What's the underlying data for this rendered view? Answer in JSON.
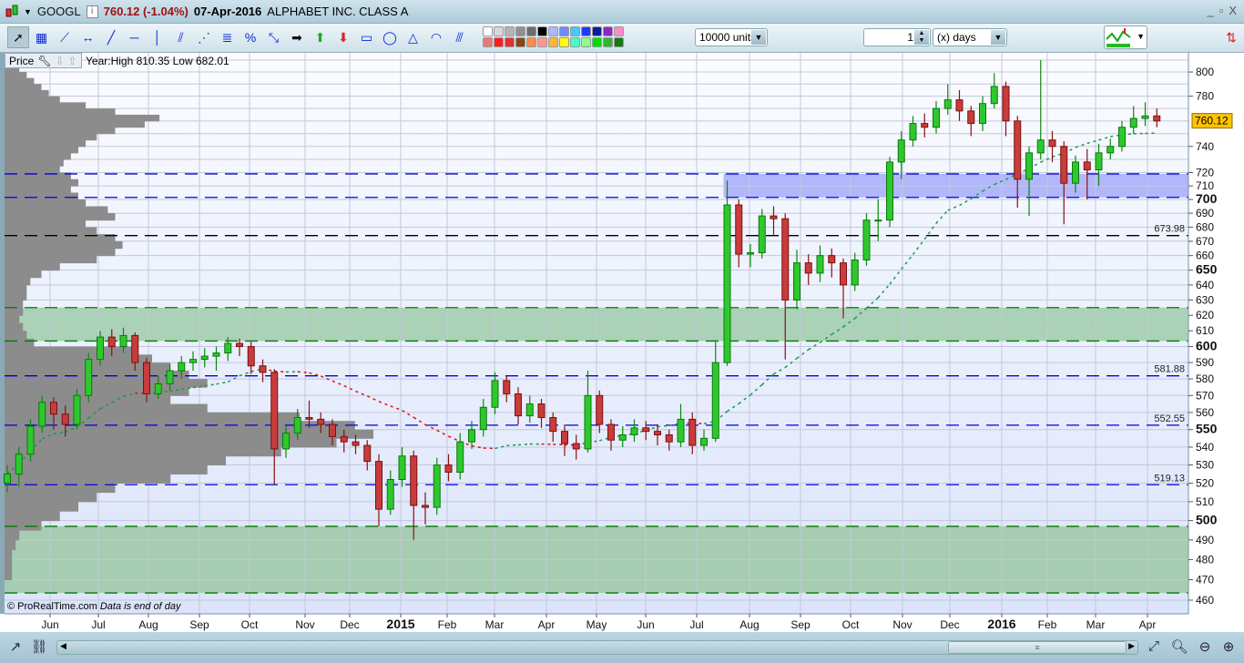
{
  "header": {
    "symbol": "GOOGL",
    "price_change": "760.12 (-1.04%)",
    "date": "07-Apr-2016",
    "name": "ALPHABET INC. CLASS A",
    "info": "i"
  },
  "window_controls": {
    "minimize": "_",
    "restore": "▫",
    "close": "X"
  },
  "toolbar": {
    "tools": [
      "pointer",
      "ruler",
      "line-segment",
      "horizontal-measure",
      "trend-line",
      "horizontal-line",
      "vertical-line",
      "channel",
      "fan-lines",
      "fibonacci-retracement",
      "percent-retracement",
      "point-to-point",
      "arrow-black",
      "arrow-up-green",
      "arrow-down-red",
      "rectangle",
      "ellipse",
      "triangle",
      "fibonacci-arcs",
      "fibonacci-fan"
    ],
    "palette": [
      "#ffffff",
      "#d8d8d8",
      "#b4b4b4",
      "#909090",
      "#6c6c6c",
      "#000000",
      "#aab8ff",
      "#6e8cff",
      "#46c8ff",
      "#1e3cff",
      "#0a1e9a",
      "#8c28c8",
      "#ff8cc8",
      "#e87878",
      "#ff1e1e",
      "#e03030",
      "#8c4614",
      "#ff8c46",
      "#ff9696",
      "#ffb432",
      "#ffff00",
      "#46ffc8",
      "#8cff8c",
      "#00dc00",
      "#32b432",
      "#147814"
    ],
    "units": "10000 units",
    "period_value": "1",
    "period_unit": "(x) days"
  },
  "panel": {
    "label": "Price",
    "year_info": "Year:High 810.35 Low 682.01",
    "copyright": "© ProRealTime.com",
    "data_note": "Data is end of day"
  },
  "chart_data": {
    "type": "candlestick",
    "interval": "weekly",
    "symbol": "GOOGL",
    "scale": "log",
    "ylim": [
      460,
      816
    ],
    "last_price": "760.12",
    "x_ticks": [
      "Jun",
      "Jul",
      "Aug",
      "Sep",
      "Oct",
      "Nov",
      "Dec",
      "2015",
      "Feb",
      "Mar",
      "Apr",
      "May",
      "Jun",
      "Jul",
      "Aug",
      "Sep",
      "Oct",
      "Nov",
      "Dec",
      "2016",
      "Feb",
      "Mar",
      "Apr"
    ],
    "y_ticks": [
      800,
      780,
      740,
      720,
      710,
      700,
      690,
      680,
      670,
      660,
      650,
      640,
      630,
      620,
      610,
      600,
      590,
      580,
      570,
      560,
      550,
      540,
      530,
      520,
      510,
      500,
      490,
      480,
      470,
      460
    ],
    "y_ticks_bold": [
      700,
      650,
      600,
      550,
      500
    ],
    "candles": [
      [
        520,
        530,
        515,
        525
      ],
      [
        525,
        540,
        518,
        536
      ],
      [
        536,
        556,
        532,
        552
      ],
      [
        552,
        570,
        548,
        566
      ],
      [
        566,
        569,
        550,
        559
      ],
      [
        559,
        564,
        546,
        553
      ],
      [
        553,
        574,
        550,
        570
      ],
      [
        570,
        596,
        566,
        592
      ],
      [
        592,
        610,
        588,
        606
      ],
      [
        606,
        611,
        594,
        600
      ],
      [
        600,
        612,
        596,
        607
      ],
      [
        607,
        609,
        585,
        590
      ],
      [
        590,
        593,
        566,
        571
      ],
      [
        571,
        582,
        568,
        577
      ],
      [
        577,
        589,
        573,
        585
      ],
      [
        585,
        594,
        580,
        590
      ],
      [
        590,
        597,
        585,
        592
      ],
      [
        592,
        599,
        587,
        594
      ],
      [
        594,
        600,
        585,
        596
      ],
      [
        596,
        606,
        591,
        602
      ],
      [
        602,
        605,
        594,
        600
      ],
      [
        600,
        603,
        583,
        588
      ],
      [
        588,
        592,
        578,
        584
      ],
      [
        584,
        586,
        519,
        539
      ],
      [
        539,
        552,
        534,
        548
      ],
      [
        548,
        562,
        544,
        557
      ],
      [
        557,
        567,
        551,
        556
      ],
      [
        556,
        560,
        548,
        553
      ],
      [
        553,
        556,
        541,
        546
      ],
      [
        546,
        550,
        537,
        543
      ],
      [
        543,
        547,
        536,
        541
      ],
      [
        541,
        544,
        527,
        532
      ],
      [
        532,
        536,
        497,
        506
      ],
      [
        506,
        527,
        503,
        522
      ],
      [
        522,
        540,
        518,
        535
      ],
      [
        535,
        538,
        490,
        508
      ],
      [
        508,
        515,
        498,
        507
      ],
      [
        507,
        534,
        503,
        530
      ],
      [
        530,
        536,
        521,
        526
      ],
      [
        526,
        548,
        522,
        543
      ],
      [
        543,
        555,
        539,
        550
      ],
      [
        550,
        568,
        546,
        563
      ],
      [
        563,
        584,
        559,
        579
      ],
      [
        579,
        582,
        566,
        571
      ],
      [
        571,
        575,
        553,
        558
      ],
      [
        558,
        570,
        554,
        565
      ],
      [
        565,
        568,
        551,
        557
      ],
      [
        557,
        560,
        543,
        549
      ],
      [
        549,
        553,
        535,
        542
      ],
      [
        542,
        547,
        533,
        539
      ],
      [
        539,
        585,
        537,
        570
      ],
      [
        570,
        573,
        548,
        553
      ],
      [
        553,
        556,
        538,
        544
      ],
      [
        544,
        552,
        540,
        547
      ],
      [
        547,
        556,
        543,
        551
      ],
      [
        551,
        555,
        544,
        549
      ],
      [
        549,
        553,
        541,
        547
      ],
      [
        547,
        550,
        538,
        543
      ],
      [
        543,
        565,
        540,
        556
      ],
      [
        556,
        560,
        536,
        541
      ],
      [
        541,
        550,
        538,
        545
      ],
      [
        545,
        604,
        543,
        590
      ],
      [
        590,
        714,
        588,
        696
      ],
      [
        696,
        700,
        652,
        661
      ],
      [
        661,
        668,
        652,
        662
      ],
      [
        662,
        693,
        658,
        688
      ],
      [
        688,
        695,
        674,
        686
      ],
      [
        686,
        690,
        592,
        630
      ],
      [
        630,
        664,
        624,
        655
      ],
      [
        655,
        661,
        640,
        648
      ],
      [
        648,
        667,
        642,
        660
      ],
      [
        660,
        665,
        645,
        655
      ],
      [
        655,
        658,
        618,
        640
      ],
      [
        640,
        662,
        636,
        657
      ],
      [
        657,
        690,
        653,
        685
      ],
      [
        685,
        700,
        670,
        685
      ],
      [
        685,
        732,
        680,
        728
      ],
      [
        728,
        752,
        715,
        745
      ],
      [
        745,
        764,
        740,
        758
      ],
      [
        758,
        766,
        747,
        755
      ],
      [
        755,
        776,
        750,
        770
      ],
      [
        770,
        790,
        765,
        777
      ],
      [
        777,
        785,
        760,
        768
      ],
      [
        768,
        772,
        748,
        758
      ],
      [
        758,
        780,
        752,
        774
      ],
      [
        774,
        799,
        770,
        788
      ],
      [
        788,
        792,
        748,
        760
      ],
      [
        760,
        764,
        694,
        715
      ],
      [
        715,
        740,
        688,
        735
      ],
      [
        735,
        810,
        730,
        745
      ],
      [
        745,
        752,
        728,
        740
      ],
      [
        740,
        744,
        682,
        712
      ],
      [
        712,
        733,
        705,
        728
      ],
      [
        728,
        738,
        700,
        722
      ],
      [
        722,
        742,
        710,
        735
      ],
      [
        735,
        746,
        730,
        740
      ],
      [
        740,
        760,
        736,
        755
      ],
      [
        755,
        772,
        750,
        762
      ],
      [
        762,
        775,
        756,
        764
      ],
      [
        764,
        770,
        755,
        760
      ]
    ],
    "moving_average": {
      "type": "SMA",
      "period": 20,
      "up_color": "#1a9a4a",
      "down_color": "#e01010"
    },
    "levels": [
      {
        "price": 673.98,
        "label": "673.98",
        "color": "#000000"
      },
      {
        "price": 581.88,
        "label": "581.88",
        "color": "#0000e0"
      },
      {
        "price": 552.55,
        "label": "552.55",
        "color": "#0000e0"
      },
      {
        "price": 519.13,
        "label": "519.13",
        "color": "#0000e0"
      },
      {
        "price": 719,
        "color": "#0000e0"
      },
      {
        "price": 701.5,
        "color": "#0000e0"
      },
      {
        "price": 625,
        "color": "#007a00"
      },
      {
        "price": 603.5,
        "color": "#007a00"
      },
      {
        "price": 497,
        "color": "#007a00"
      },
      {
        "price": 463.5,
        "color": "#007a00"
      }
    ],
    "zones": [
      {
        "from": 603.5,
        "to": 625,
        "color": "#a9d2b6",
        "start_candle": 0
      },
      {
        "from": 463.5,
        "to": 497,
        "color": "#a6cdb2",
        "start_candle": 0
      },
      {
        "from": 701.5,
        "to": 719,
        "color": "#b2b6fb",
        "start_candle": 62
      }
    ],
    "volume_profile": {
      "bucket_start": 460,
      "bucket_size": 5,
      "relative_volume": [
        0,
        0,
        0.02,
        0.02,
        0.02,
        0.03,
        0.04,
        0.1,
        0.15,
        0.2,
        0.25,
        0.3,
        0.45,
        0.55,
        0.6,
        0.75,
        0.9,
        1.0,
        0.95,
        0.8,
        0.55,
        0.45,
        0.5,
        0.55,
        0.5,
        0.45,
        0.4,
        0.35,
        0.08,
        0.06,
        0.05,
        0.04,
        0.05,
        0.05,
        0.06,
        0.06,
        0.07,
        0.1,
        0.15,
        0.25,
        0.3,
        0.32,
        0.3,
        0.25,
        0.22,
        0.3,
        0.28,
        0.22,
        0.2,
        0.18,
        0.2,
        0.18,
        0.15,
        0.16,
        0.18,
        0.2,
        0.22,
        0.25,
        0.3,
        0.38,
        0.42,
        0.3,
        0.22,
        0.15,
        0.12,
        0.1,
        0.08,
        0.06,
        0.04,
        0.02
      ]
    }
  }
}
